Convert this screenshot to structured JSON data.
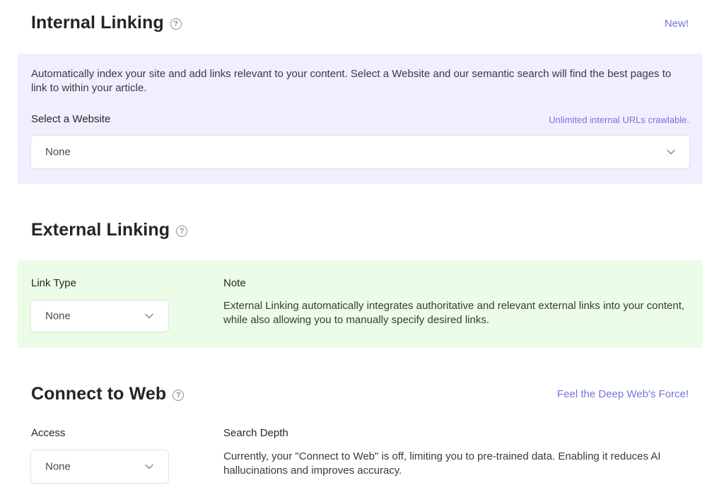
{
  "internal": {
    "title": "Internal Linking",
    "badge": "New!",
    "description": "Automatically index your site and add links relevant to your content. Select a Website and our semantic search will find the best pages to link to within your article.",
    "select_label": "Select a Website",
    "hint": "Unlimited internal URLs crawlable.",
    "select_value": "None"
  },
  "external": {
    "title": "External Linking",
    "link_type_label": "Link Type",
    "link_type_value": "None",
    "note_label": "Note",
    "note_text": "External Linking automatically integrates authoritative and relevant external links into your content, while also allowing you to manually specify desired links."
  },
  "web": {
    "title": "Connect to Web",
    "tagline": "Feel the Deep Web's Force!",
    "access_label": "Access",
    "access_value": "None",
    "depth_label": "Search Depth",
    "depth_text": "Currently, your \"Connect to Web\" is off, limiting you to pre-trained data. Enabling it reduces AI hallucinations and improves accuracy."
  },
  "icons": {
    "help": "help-circle-icon",
    "chevron": "chevron-down-icon"
  },
  "colors": {
    "accent": "#7275dc",
    "internal_panel": "#f2eeff",
    "external_panel": "#ebfde7"
  }
}
